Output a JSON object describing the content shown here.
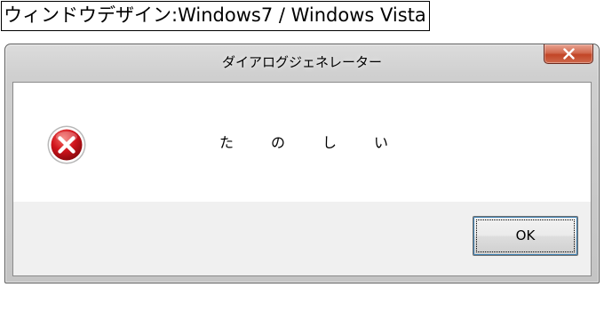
{
  "caption": "ウィンドウデザイン:Windows7 / Windows Vista",
  "window": {
    "title": "ダイアログジェネレーター",
    "close_icon": "close-icon",
    "message": "たのしい",
    "status_icon": "error-icon",
    "ok_label": "OK"
  },
  "colors": {
    "close_button": "#c24526",
    "error_red": "#d0141c",
    "ok_focus_border": "#3c7fb1"
  }
}
